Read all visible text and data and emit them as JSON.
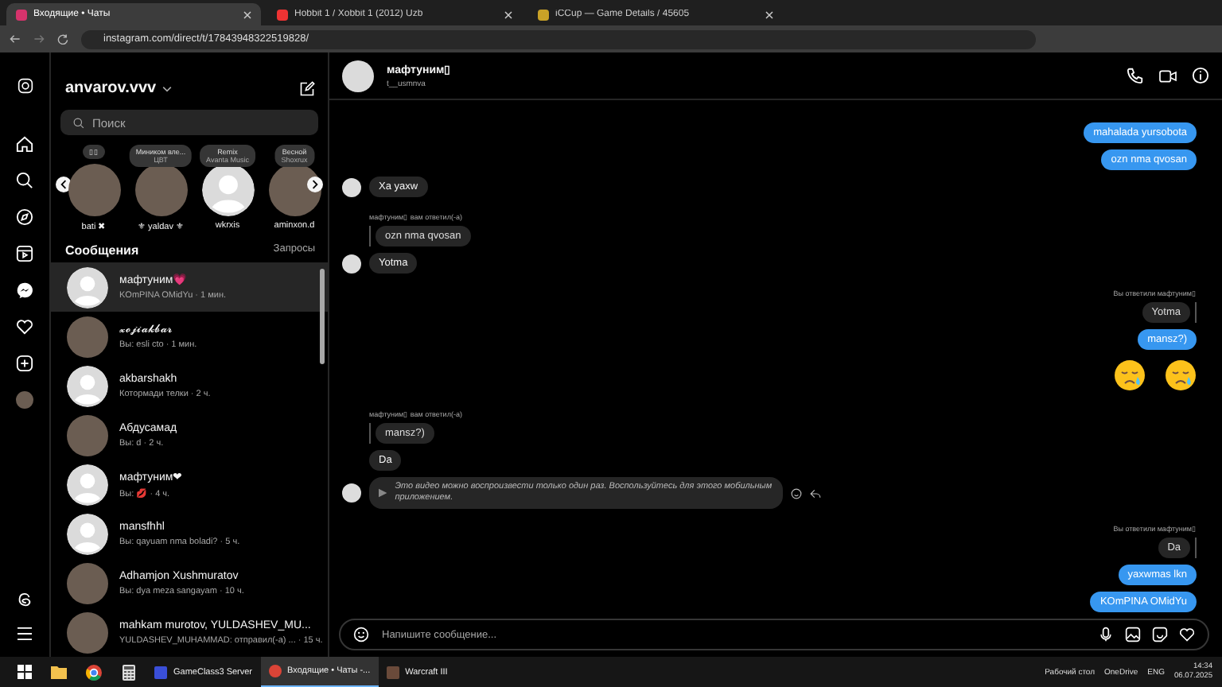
{
  "browser": {
    "tabs": [
      {
        "title": "Входящие • Чаты",
        "selected": true
      },
      {
        "title": "Hobbit 1 / Xobbit 1 (2012) Uzb",
        "selected": false
      },
      {
        "title": "iCCup — Game Details / 45605",
        "selected": false
      }
    ],
    "url": "instagram.com/direct/t/17843948322519828/"
  },
  "inbox": {
    "username": "anvarov.vvv",
    "search_placeholder": "Поиск",
    "stories": [
      {
        "note": "▯▯",
        "name": "bati ✖",
        "has_photo": true
      },
      {
        "note": "Миником вле...",
        "artist": "ЦВТ",
        "name": "⚜ yaldav ⚜",
        "has_photo": true
      },
      {
        "note": "Remix",
        "artist": "Avanta Music",
        "name": "wkrxis",
        "has_photo": false
      },
      {
        "note": "Весной",
        "artist": "Shoxrux",
        "name": "aminxon.d",
        "has_photo": true
      }
    ],
    "section_title": "Сообщения",
    "requests": "Запросы",
    "conversations": [
      {
        "name": "мафтуним💗",
        "preview": "KOmPINA OMidYu · 1 мин.",
        "has_photo": false,
        "selected": true
      },
      {
        "name": "𝔁𝓸𝓳𝓲𝓪𝓴𝓫𝓪𝓻",
        "preview": "Вы: esli cto · 1 мин.",
        "has_photo": true,
        "selected": false
      },
      {
        "name": "akbarshakh",
        "preview": "Котормади телки · 2 ч.",
        "has_photo": false,
        "selected": false
      },
      {
        "name": "Абдусамад",
        "preview": "Вы: d · 2 ч.",
        "has_photo": true,
        "selected": false
      },
      {
        "name": "мафтуним❤",
        "preview": "Вы: 💋 · 4 ч.",
        "has_photo": false,
        "selected": false
      },
      {
        "name": "mansfhhl",
        "preview": "Вы: qayuam nma boladi? · 5 ч.",
        "has_photo": false,
        "selected": false
      },
      {
        "name": "Adhamjon Xushmuratov",
        "preview": "Вы: dya meza sangayam · 10 ч.",
        "has_photo": true,
        "selected": false
      },
      {
        "name": "mahkam murotov, YULDASHEV_MU...",
        "preview": "YULDASHEV_MUHAMMAD: отправил(-а) ... · 15 ч.",
        "has_photo": true,
        "selected": false
      }
    ]
  },
  "chat": {
    "name": "мафтуним▯",
    "handle": "t__usmnva",
    "messages": [
      {
        "kind": "out",
        "text": "mahalada yursobota"
      },
      {
        "kind": "out",
        "text": "ozn nma qvosan"
      },
      {
        "kind": "in",
        "text": "Xa yaxw",
        "avatar": true
      },
      {
        "kind": "reply",
        "outgoing": false,
        "label": "мафтуним▯ вам ответил(-а)",
        "text": "ozn nma qvosan"
      },
      {
        "kind": "in",
        "text": "Yotma",
        "avatar": true
      },
      {
        "kind": "reply",
        "outgoing": true,
        "label": "Вы ответили мафтуним▯",
        "text": "Yotma"
      },
      {
        "kind": "out",
        "text": "mansz?)"
      },
      {
        "kind": "emoji"
      },
      {
        "kind": "reply",
        "outgoing": false,
        "label": "мафтуним▯ вам ответил(-а)",
        "text": "mansz?)"
      },
      {
        "kind": "in",
        "text": "Da",
        "avatar": false
      },
      {
        "kind": "video",
        "text": "Это видео можно воспроизвести только один раз. Воспользуйтесь для этого мобильным приложением."
      },
      {
        "kind": "reply",
        "outgoing": true,
        "label": "Вы ответили мафтуним▯",
        "text": "Da"
      },
      {
        "kind": "out",
        "text": "yaxwmas lkn"
      },
      {
        "kind": "out",
        "text": "KOmPINA OMidYu"
      }
    ],
    "input_placeholder": "Напишите сообщение..."
  },
  "taskbar": {
    "apps": [
      {
        "label": "GameClass3 Server",
        "active": false
      },
      {
        "label": "Входящие • Чаты -...",
        "active": true
      },
      {
        "label": "Warcraft III",
        "active": false
      }
    ],
    "desktop": "Рабочий стол",
    "onedrive": "OneDrive",
    "lang": "ENG",
    "time": "14:34",
    "date": "06.07.2025"
  }
}
